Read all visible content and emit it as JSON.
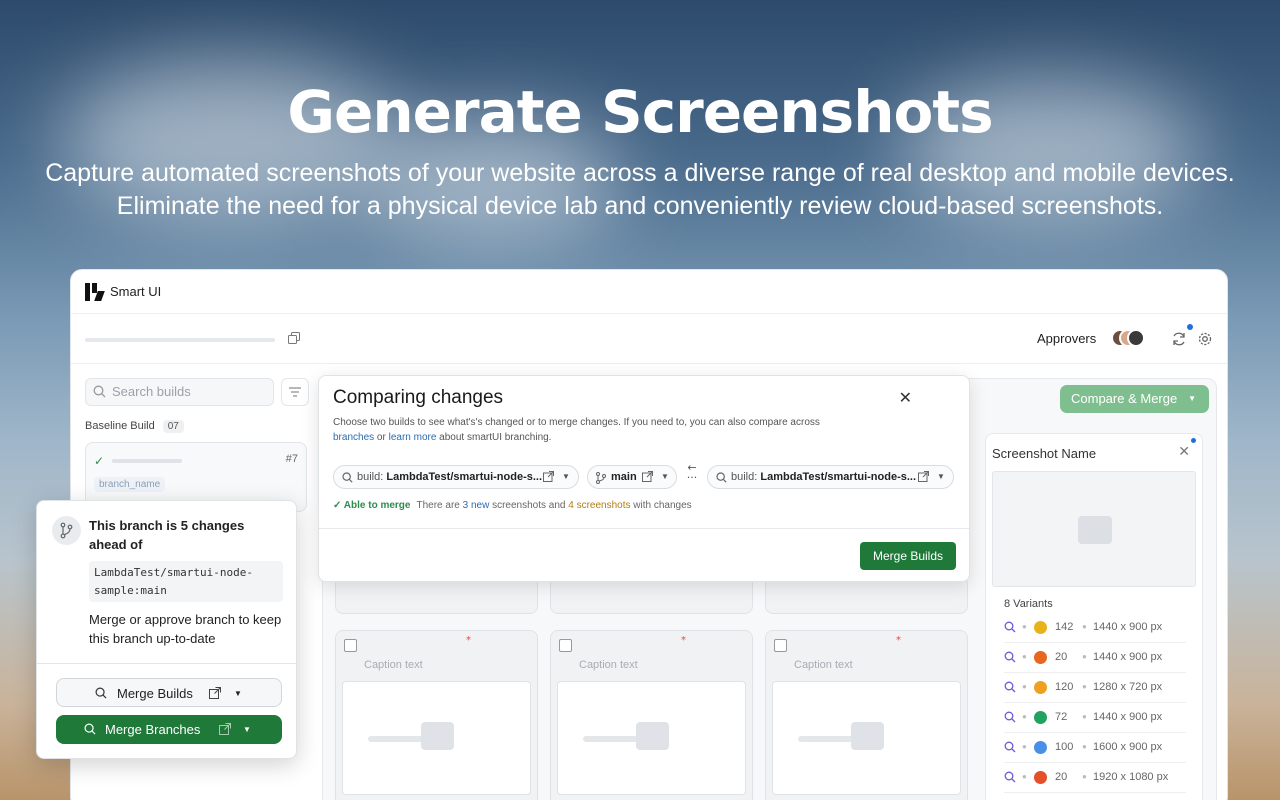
{
  "hero": {
    "title": "Generate Screenshots",
    "subtitle_line1": "Capture automated screenshots of your website across a diverse range of real desktop and mobile devices.",
    "subtitle_line2": "Eliminate the need for a physical device lab and conveniently review cloud-based screenshots."
  },
  "app": {
    "title": "Smart UI",
    "approvers_label": "Approvers",
    "search_placeholder": "Search builds",
    "baseline_label": "Baseline Build",
    "baseline_count": "07",
    "build_number": "#7",
    "branch_name": "branch_name",
    "compare_merge_label": "Compare & Merge",
    "accent": "#1f7a3a"
  },
  "modal": {
    "title": "Comparing changes",
    "desc_part1": "Choose two builds to see what's's changed or to merge changes. If you need to, you can also compare across",
    "desc_link1": "branches",
    "desc_mid": " or ",
    "desc_link2": "learn more",
    "desc_part2": " about smartUI branching.",
    "base_prefix": "build: ",
    "base_value": "LambdaTest/smartui-node-s...",
    "branch_value": "main",
    "compare_prefix": "build: ",
    "compare_value": "LambdaTest/smartui-node-s...",
    "status_ok": "Able to merge",
    "status_text1": "There are ",
    "status_new": "3 new",
    "status_text2": " screenshots and ",
    "status_changes": "4 screenshots",
    "status_text3": " with changes",
    "merge_button": "Merge Builds"
  },
  "tiles": {
    "caption": "Caption text"
  },
  "side_panel": {
    "title": "Screenshot Name",
    "variants_label": "8 Variants",
    "variants": [
      {
        "browser": "chrome",
        "color": "#e8b21a",
        "version": "142",
        "resolution": "1440 x 900 px"
      },
      {
        "browser": "firefox",
        "color": "#e8661f",
        "version": "20",
        "resolution": "1440 x 900 px"
      },
      {
        "browser": "uc",
        "color": "#f0a020",
        "version": "120",
        "resolution": "1280 x 720 px"
      },
      {
        "browser": "edge",
        "color": "#1fa35f",
        "version": "72",
        "resolution": "1440 x 900 px"
      },
      {
        "browser": "chromium",
        "color": "#4a8fe7",
        "version": "100",
        "resolution": "1600 x 900 px"
      },
      {
        "browser": "brave",
        "color": "#e4502a",
        "version": "20",
        "resolution": "1920 x 1080 px"
      }
    ]
  },
  "popover": {
    "title": "This branch is 5 changes ahead of",
    "code": "LambdaTest/smartui-node-sample:main",
    "body": "Merge or approve branch to keep this branch up-to-date",
    "merge_builds": "Merge Builds",
    "merge_branches": "Merge Branches"
  }
}
